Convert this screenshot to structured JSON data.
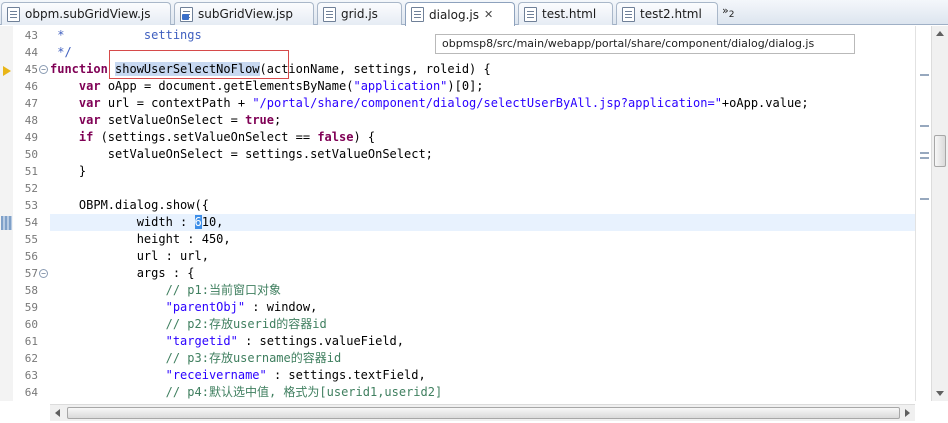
{
  "tabs": [
    {
      "label": "obpm.subGridView.js",
      "icon": "js-file-icon",
      "active": false
    },
    {
      "label": "subGridView.jsp",
      "icon": "jsp-file-icon",
      "active": false
    },
    {
      "label": "grid.js",
      "icon": "js-file-icon",
      "active": false
    },
    {
      "label": "dialog.js",
      "icon": "js-file-icon",
      "active": true,
      "close": "✕"
    },
    {
      "label": "test.html",
      "icon": "html-file-icon",
      "active": false
    },
    {
      "label": "test2.html",
      "icon": "html-file-icon",
      "active": false
    }
  ],
  "overflow": {
    "chevron": "»",
    "count": "2"
  },
  "tooltip": "obpmsp8/src/main/webapp/portal/share/component/dialog/dialog.js",
  "line_numbers": [
    "43",
    "44",
    "45",
    "46",
    "47",
    "48",
    "49",
    "50",
    "51",
    "52",
    "53",
    "54",
    "55",
    "56",
    "57",
    "58",
    "59",
    "60",
    "61",
    "62",
    "63",
    "64"
  ],
  "fold_glyph": "−",
  "code": {
    "l43": {
      "t0": " *           settings"
    },
    "l44": {
      "t0": " */"
    },
    "l45": {
      "t0": "function",
      "t1": " ",
      "t2": "showUserSelectNoFlow",
      "t3": "(actionName, settings, roleid) {"
    },
    "l46": {
      "t0": "    ",
      "t1": "var",
      "t2": " oApp = document.getElementsByName(",
      "t3": "\"application\"",
      "t4": ")[0];"
    },
    "l47": {
      "t0": "    ",
      "t1": "var",
      "t2": " url = contextPath + ",
      "t3": "\"/portal/share/component/dialog/selectUserByAll.jsp?application=\"",
      "t4": "+oApp.value;"
    },
    "l48": {
      "t0": "    ",
      "t1": "var",
      "t2": " setValueOnSelect = ",
      "t3": "true",
      "t4": ";"
    },
    "l49": {
      "t0": "    ",
      "t1": "if",
      "t2": " (settings.setValueOnSelect == ",
      "t3": "false",
      "t4": ") {"
    },
    "l50": {
      "t0": "        setValueOnSelect = settings.setValueOnSelect;"
    },
    "l51": {
      "t0": "    }"
    },
    "l52": {
      "t0": ""
    },
    "l53": {
      "t0": "    OBPM.dialog.show({"
    },
    "l54": {
      "t0": "            width : ",
      "t1": "6",
      "t2": "10,"
    },
    "l55": {
      "t0": "            height : 450,"
    },
    "l56": {
      "t0": "            url : url,"
    },
    "l57": {
      "t0": "            args : {"
    },
    "l58": {
      "t0": "                ",
      "t1": "// p1:当前窗口对象"
    },
    "l59": {
      "t0": "                ",
      "t1": "\"parentObj\"",
      "t2": " : window,"
    },
    "l60": {
      "t0": "                ",
      "t1": "// p2:存放userid的容器id"
    },
    "l61": {
      "t0": "                ",
      "t1": "\"targetid\"",
      "t2": " : settings.valueField,"
    },
    "l62": {
      "t0": "                ",
      "t1": "// p3:存放username的容器id"
    },
    "l63": {
      "t0": "                ",
      "t1": "\"receivername\"",
      "t2": " : settings.textField,"
    },
    "l64": {
      "t0": "                ",
      "t1": "// p4:默认选中值, 格式为[userid1,userid2]"
    }
  },
  "colors": {
    "keyword": "#7f0055",
    "string": "#2a00ff",
    "comment": "#3f7f5f",
    "javadoc": "#3f5fbf",
    "current_line": "#e8f2fe",
    "selection": "#c7d8f1",
    "hover_box": "#d64a4a"
  }
}
